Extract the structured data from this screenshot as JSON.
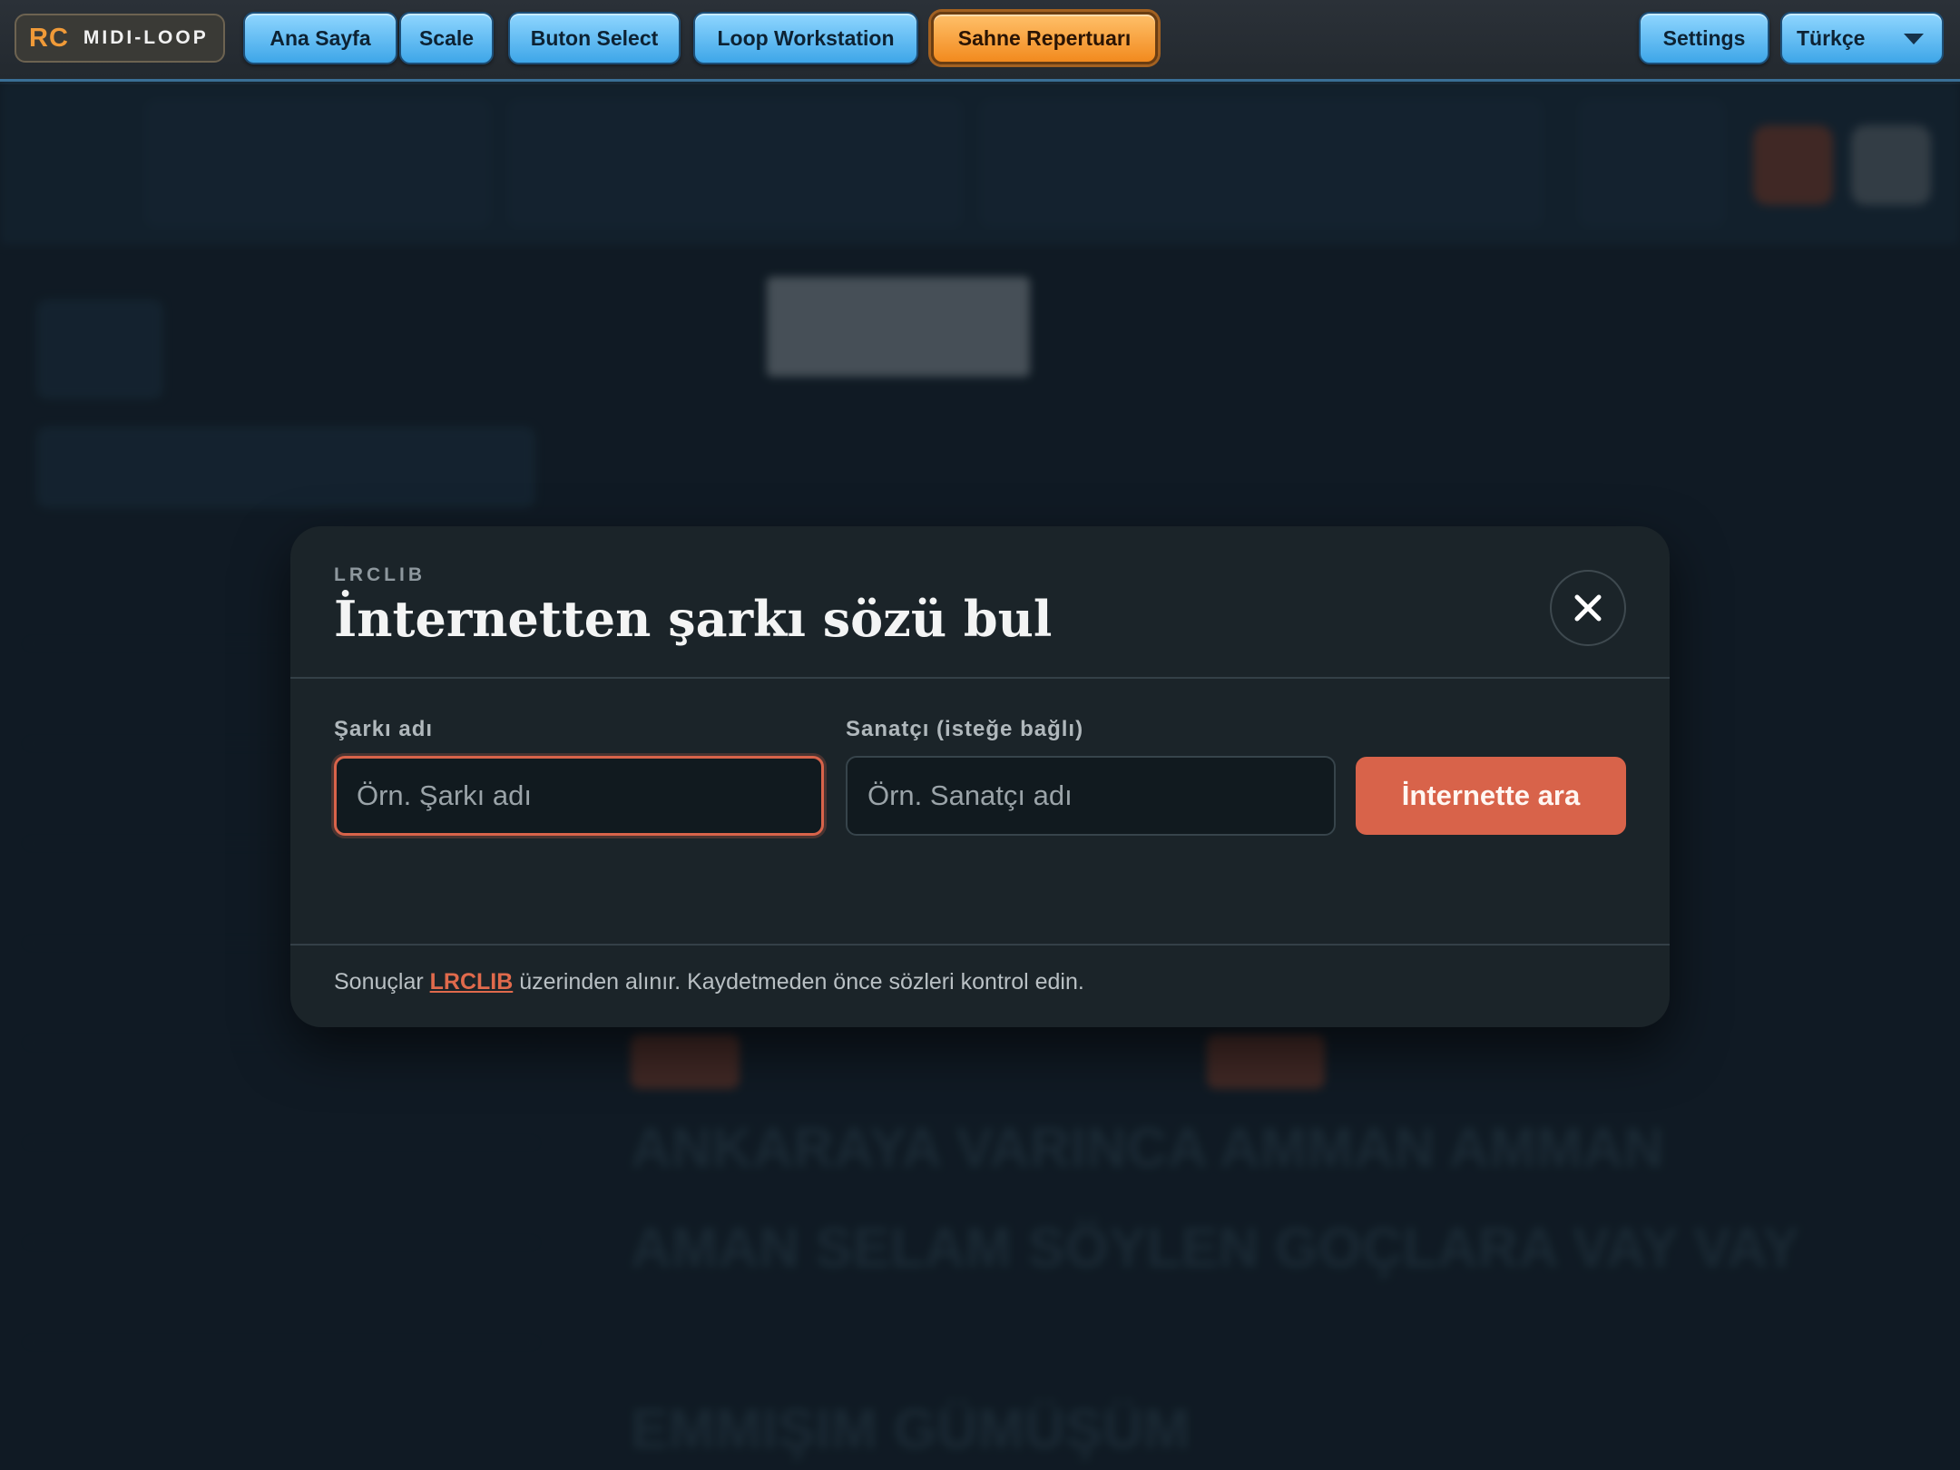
{
  "app": {
    "logo_mark": "RC",
    "logo_text": "MIDI-LOOP"
  },
  "nav": {
    "items": [
      {
        "label": "Ana Sayfa"
      },
      {
        "label": "Scale"
      },
      {
        "label": "Buton Select"
      },
      {
        "label": "Loop Workstation"
      },
      {
        "label": "Sahne Repertuarı",
        "active": true
      }
    ],
    "settings_label": "Settings",
    "language_value": "Türkçe"
  },
  "background": {
    "lyrics": [
      "ANKARAYA VARINCA AMMAN AMMAN",
      "AMAN SELAM SÖYLEN GOÇLARA VAY VAY",
      "EMMIŞIM GÜMÜŞÜM"
    ]
  },
  "modal": {
    "eyebrow": "LRCLIB",
    "title": "İnternetten şarkı sözü bul",
    "song_label": "Şarkı adı",
    "song_value": "",
    "song_placeholder": "Örn. Şarkı adı",
    "artist_label": "Sanatçı (isteğe bağlı)",
    "artist_value": "",
    "artist_placeholder": "Örn. Sanatçı adı",
    "search_label": "İnternette ara",
    "footnote_prefix": "Sonuçlar",
    "footnote_link": "LRCLIB",
    "footnote_suffix": "üzerinden alınır. Kaydetmeden önce sözleri kontrol edin."
  },
  "icons": {
    "close": "close-icon",
    "dropdown": "chevron-down-icon"
  },
  "colors": {
    "accent": "#d8634a",
    "nav_blue": "#3ea6e8",
    "nav_active": "#f28a1e",
    "modal_bg": "#1b2429"
  }
}
